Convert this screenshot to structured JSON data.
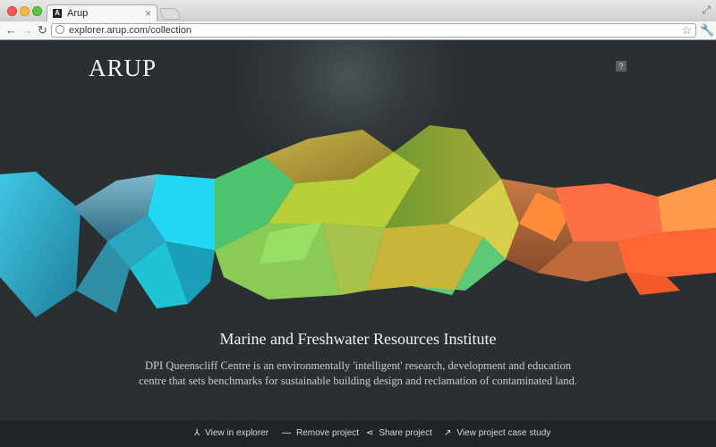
{
  "browser": {
    "tab_title": "Arup",
    "tab_favicon_letter": "A",
    "url": "explorer.arup.com/collection"
  },
  "header": {
    "logo": "ARUP",
    "help_label": "?"
  },
  "project": {
    "title": "Marine and Freshwater Resources Institute",
    "description": "DPI Queenscliff Centre is an environmentally 'intelligent' research, development and education centre that sets benchmarks for sustainable building design and reclamation of contaminated land."
  },
  "actions": [
    {
      "label": "View in explorer",
      "icon": "explorer-icon"
    },
    {
      "label": "Remove project",
      "icon": "minus-icon"
    },
    {
      "label": "Share project",
      "icon": "share-icon"
    },
    {
      "label": "View project case study",
      "icon": "arrow-up-right-icon"
    }
  ],
  "colors": {
    "background": "#2a2f33",
    "cyan": "#22d4ee",
    "green": "#6fd06a",
    "lime": "#a8d84a",
    "orange": "#ff6a3c"
  }
}
